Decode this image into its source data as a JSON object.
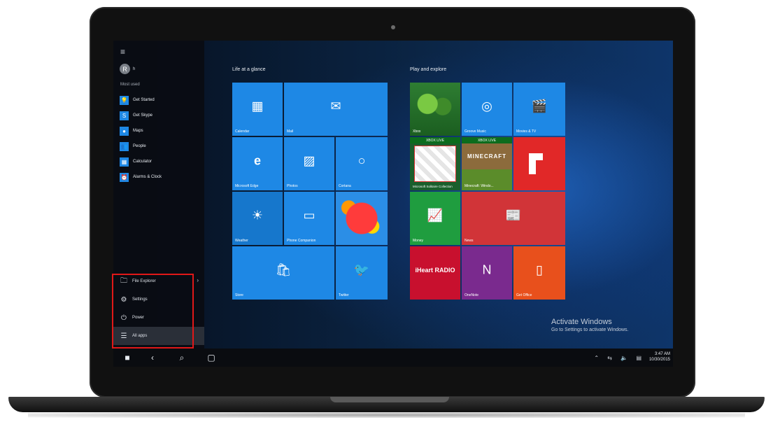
{
  "start_menu": {
    "user_name": "h",
    "user_initial": "R",
    "most_used_label": "Most used",
    "most_used": [
      {
        "label": "Get Started",
        "icon": "lightbulb-icon"
      },
      {
        "label": "Get Skype",
        "icon": "skype-icon"
      },
      {
        "label": "Maps",
        "icon": "maps-icon"
      },
      {
        "label": "People",
        "icon": "people-icon"
      },
      {
        "label": "Calculator",
        "icon": "calculator-icon"
      },
      {
        "label": "Alarms & Clock",
        "icon": "clock-icon"
      }
    ],
    "bottom_items": [
      {
        "label": "File Explorer",
        "icon": "folder-icon"
      },
      {
        "label": "Settings",
        "icon": "gear-icon"
      },
      {
        "label": "Power",
        "icon": "power-icon"
      },
      {
        "label": "All apps",
        "icon": "list-icon"
      }
    ]
  },
  "groups": {
    "life": "Life at a glance",
    "play": "Play and explore"
  },
  "tiles": {
    "calendar": "Calendar",
    "mail": "Mail",
    "edge": "Microsoft Edge",
    "photos": "Photos",
    "cortana": "Cortana",
    "weather": "Weather",
    "phone_companion": "Phone Companion",
    "store": "Store",
    "twitter": "Twitter",
    "xbox": "Xbox",
    "groove": "Groove Music",
    "movies": "Movies & TV",
    "xbox_live_1": "XBOX LIVE",
    "xbox_live_2": "XBOX LIVE",
    "solitaire": "Microsoft Solitaire Collection",
    "minecraft_title": "MINECRAFT",
    "minecraft": "Minecraft: Windo...",
    "money": "Money",
    "news": "News",
    "iheart": "iHeart RADIO",
    "onenote": "OneNote",
    "office": "Get Office"
  },
  "watermark": {
    "title": "Activate Windows",
    "subtitle": "Go to Settings to activate Windows."
  },
  "taskbar": {
    "time": "3:47 AM",
    "date": "10/30/2015"
  },
  "colors": {
    "tile_blue": "#1e88e5",
    "tile_green": "#1f9d3f",
    "tile_red": "#d13438",
    "tile_orange": "#e8501c",
    "onenote_purple": "#7a2a8e",
    "highlight": "#e01818"
  }
}
